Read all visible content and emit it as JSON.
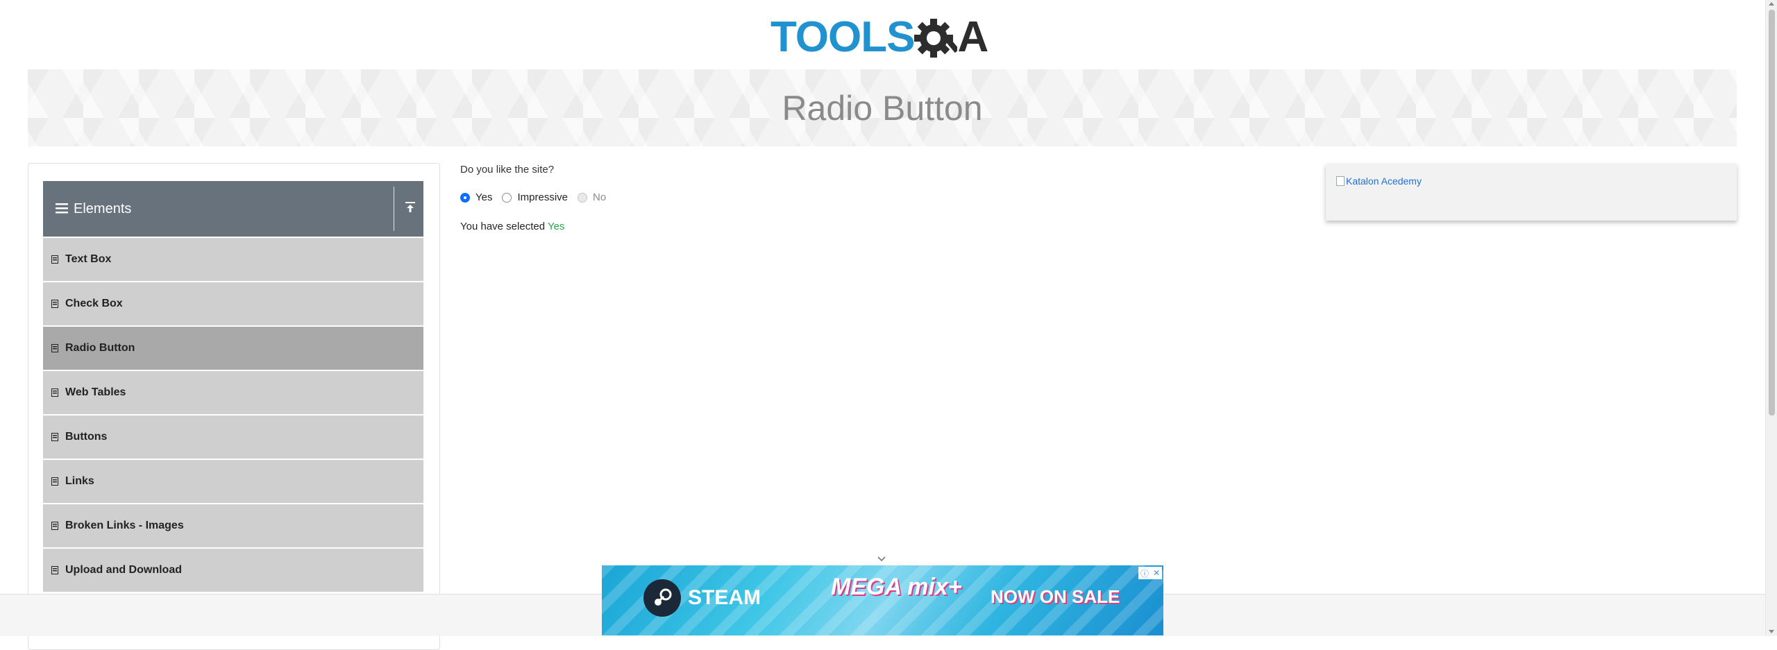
{
  "header": {
    "logo_part1": "TOOLS",
    "logo_part2": "A"
  },
  "banner": {
    "title": "Radio Button"
  },
  "sidebar": {
    "group_title": "Elements",
    "items": [
      {
        "label": "Text Box"
      },
      {
        "label": "Check Box"
      },
      {
        "label": "Radio Button",
        "active": true
      },
      {
        "label": "Web Tables"
      },
      {
        "label": "Buttons"
      },
      {
        "label": "Links"
      },
      {
        "label": "Broken Links - Images"
      },
      {
        "label": "Upload and Download"
      }
    ]
  },
  "main": {
    "question": "Do you like the site?",
    "options": [
      {
        "label": "Yes",
        "state": "checked"
      },
      {
        "label": "Impressive",
        "state": "unchecked"
      },
      {
        "label": "No",
        "state": "disabled"
      }
    ],
    "result_prefix": "You have selected",
    "result_value": "Yes"
  },
  "right_ad": {
    "alt_text": "Katalon Acedemy"
  },
  "footer_ad": {
    "brand": "STEAM",
    "game_title": "MEGA mix+",
    "sale_text": "NOW ON SALE"
  },
  "colors": {
    "brand_blue": "#1f92cf",
    "sidebar_header": "#68727c",
    "menu_item": "#cfcfcf",
    "menu_active": "#a9a9a9",
    "success": "#28a745",
    "radio_checked": "#0d6efd"
  },
  "icons": {
    "hamburger": "menu-hamburger-icon",
    "collapse": "collapse-upload-icon",
    "menu_item": "element-item-icon",
    "chevron": "chevron-down-icon"
  }
}
